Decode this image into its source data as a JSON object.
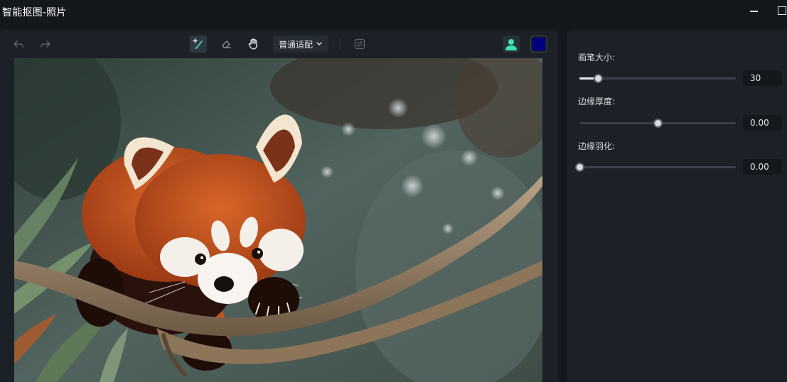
{
  "window": {
    "title": "智能抠图-照片"
  },
  "toolbar": {
    "fit_mode": "普通适配",
    "brush_color": "#000080",
    "active_tool": "brush"
  },
  "settings": {
    "brush_size": {
      "label": "画笔大小:",
      "value": "30",
      "fraction": 0.12
    },
    "edge_thickness": {
      "label": "边缘厚度:",
      "value": "0.00",
      "fraction": 0.5
    },
    "edge_feather": {
      "label": "边缘羽化:",
      "value": "0.00",
      "fraction": 0.0
    }
  },
  "colors": {
    "accent": "#3ee0b4",
    "panel": "#1c2127",
    "background": "#14181d"
  },
  "icons": [
    "undo-icon",
    "redo-icon",
    "brush-add-icon",
    "eraser-icon",
    "hand-icon",
    "chevron-down-icon",
    "swap-icon",
    "person-icon"
  ]
}
